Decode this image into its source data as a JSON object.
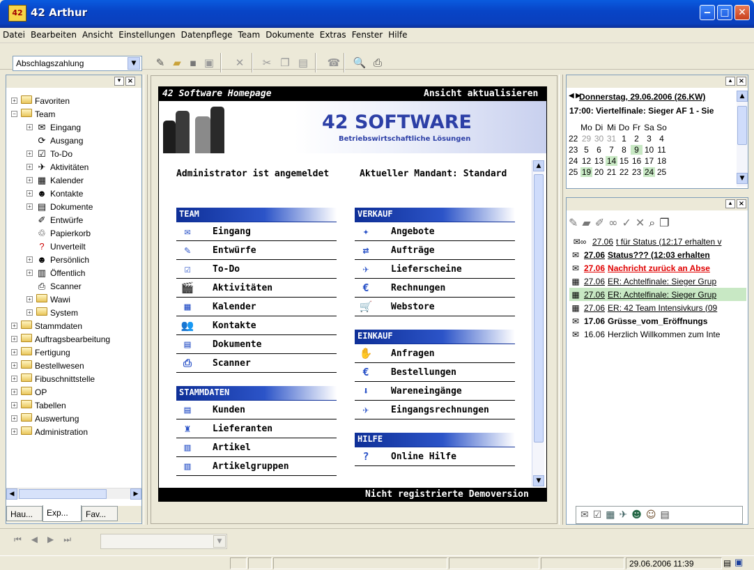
{
  "window": {
    "title": "42 Arthur",
    "icon": "42"
  },
  "menu": [
    "Datei",
    "Bearbeiten",
    "Ansicht",
    "Einstellungen",
    "Datenpflege",
    "Team",
    "Dokumente",
    "Extras",
    "Fenster",
    "Hilfe"
  ],
  "toolbar": {
    "combo_value": "Abschlagszahlung"
  },
  "tree": [
    {
      "label": "Favoriten",
      "level": 0,
      "toggle": "+",
      "icon": "favorites-folder-icon"
    },
    {
      "label": "Team",
      "level": 0,
      "toggle": "−",
      "icon": "folder-icon"
    },
    {
      "label": "Eingang",
      "level": 1,
      "toggle": "+",
      "icon": "envelope-icon"
    },
    {
      "label": "Ausgang",
      "level": 1,
      "toggle": "",
      "icon": "outbox-icon"
    },
    {
      "label": "To-Do",
      "level": 1,
      "toggle": "+",
      "icon": "todo-icon"
    },
    {
      "label": "Aktivitäten",
      "level": 1,
      "toggle": "+",
      "icon": "activities-icon"
    },
    {
      "label": "Kalender",
      "level": 1,
      "toggle": "+",
      "icon": "calendar-icon"
    },
    {
      "label": "Kontakte",
      "level": 1,
      "toggle": "+",
      "icon": "contacts-icon"
    },
    {
      "label": "Dokumente",
      "level": 1,
      "toggle": "+",
      "icon": "documents-icon"
    },
    {
      "label": "Entwürfe",
      "level": 1,
      "toggle": "",
      "icon": "drafts-icon"
    },
    {
      "label": "Papierkorb",
      "level": 1,
      "toggle": "",
      "icon": "trash-icon"
    },
    {
      "label": "Unverteilt",
      "level": 1,
      "toggle": "",
      "icon": "question-icon"
    },
    {
      "label": "Persönlich",
      "level": 1,
      "toggle": "+",
      "icon": "personal-icon"
    },
    {
      "label": "Öffentlich",
      "level": 1,
      "toggle": "+",
      "icon": "public-icon"
    },
    {
      "label": "Scanner",
      "level": 1,
      "toggle": "",
      "icon": "scanner-icon"
    },
    {
      "label": "Wawi",
      "level": 1,
      "toggle": "+",
      "icon": "folder-icon"
    },
    {
      "label": "System",
      "level": 1,
      "toggle": "+",
      "icon": "folder-icon"
    },
    {
      "label": "Stammdaten",
      "level": 0,
      "toggle": "+",
      "icon": "folder-icon"
    },
    {
      "label": "Auftragsbearbeitung",
      "level": 0,
      "toggle": "+",
      "icon": "folder-icon"
    },
    {
      "label": "Fertigung",
      "level": 0,
      "toggle": "+",
      "icon": "folder-icon"
    },
    {
      "label": "Bestellwesen",
      "level": 0,
      "toggle": "+",
      "icon": "folder-icon"
    },
    {
      "label": "Fibuschnittstelle",
      "level": 0,
      "toggle": "+",
      "icon": "folder-icon"
    },
    {
      "label": "OP",
      "level": 0,
      "toggle": "+",
      "icon": "folder-icon"
    },
    {
      "label": "Tabellen",
      "level": 0,
      "toggle": "+",
      "icon": "folder-icon"
    },
    {
      "label": "Auswertung",
      "level": 0,
      "toggle": "+",
      "icon": "folder-icon"
    },
    {
      "label": "Administration",
      "level": 0,
      "toggle": "+",
      "icon": "folder-icon"
    }
  ],
  "left_tabs": [
    "Hau...",
    "Exp...",
    "Fav..."
  ],
  "homepage": {
    "title": "42 Software Homepage",
    "refresh": "Ansicht aktualisieren",
    "brand": "42 SOFTWARE",
    "tagline": "Betriebswirtschaftliche Lösungen",
    "admin": "Administrator ist angemeldet",
    "mandant": "Aktueller Mandant: Standard",
    "footer": "Nicht registrierte Demoversion",
    "left_sections": [
      {
        "title": "TEAM",
        "items": [
          {
            "label": "Eingang",
            "icon": "envelope-icon",
            "glyph": "✉"
          },
          {
            "label": "Entwürfe",
            "icon": "drafts-icon",
            "glyph": "✎"
          },
          {
            "label": "To-Do",
            "icon": "todo-icon",
            "glyph": "☑"
          },
          {
            "label": "Aktivitäten",
            "icon": "activities-icon",
            "glyph": "🎬"
          },
          {
            "label": "Kalender",
            "icon": "calendar-icon",
            "glyph": "▦"
          },
          {
            "label": "Kontakte",
            "icon": "contacts-icon",
            "glyph": "👥"
          },
          {
            "label": "Dokumente",
            "icon": "documents-icon",
            "glyph": "▤"
          },
          {
            "label": "Scanner",
            "icon": "scanner-icon",
            "glyph": "⎙"
          }
        ]
      },
      {
        "title": "STAMMDATEN",
        "items": [
          {
            "label": "Kunden",
            "icon": "customers-icon",
            "glyph": "▤"
          },
          {
            "label": "Lieferanten",
            "icon": "suppliers-icon",
            "glyph": "♜"
          },
          {
            "label": "Artikel",
            "icon": "barcode-icon",
            "glyph": "▥"
          },
          {
            "label": "Artikelgruppen",
            "icon": "barcode-group-icon",
            "glyph": "▥"
          }
        ]
      }
    ],
    "right_sections": [
      {
        "title": "VERKAUF",
        "items": [
          {
            "label": "Angebote",
            "icon": "offers-icon",
            "glyph": "✦"
          },
          {
            "label": "Aufträge",
            "icon": "orders-icon",
            "glyph": "⇄"
          },
          {
            "label": "Lieferscheine",
            "icon": "delivery-icon",
            "glyph": "✈"
          },
          {
            "label": "Rechnungen",
            "icon": "invoice-icon",
            "glyph": "€"
          },
          {
            "label": "Webstore",
            "icon": "cart-icon",
            "glyph": "🛒"
          }
        ]
      },
      {
        "title": "EINKAUF",
        "items": [
          {
            "label": "Anfragen",
            "icon": "requests-icon",
            "glyph": "✋"
          },
          {
            "label": "Bestellungen",
            "icon": "order-euro-icon",
            "glyph": "€"
          },
          {
            "label": "Wareneingänge",
            "icon": "goods-receipt-icon",
            "glyph": "⬇"
          },
          {
            "label": "Eingangsrechnungen",
            "icon": "incoming-invoice-icon",
            "glyph": "✈"
          }
        ]
      },
      {
        "title": "HILFE",
        "items": [
          {
            "label": "Online Hilfe",
            "icon": "help-icon",
            "glyph": "?"
          }
        ]
      }
    ]
  },
  "calendar": {
    "date_title": "Donnerstag, 29.06.2006 (26.KW)",
    "event": "17:00: Viertelfinale: Sieger AF 1 - Sie",
    "weekdays": [
      "Mo",
      "Di",
      "Mi",
      "Do",
      "Fr",
      "Sa",
      "So"
    ],
    "weeks": [
      {
        "kw": "22",
        "days": [
          {
            "d": "29",
            "dim": true
          },
          {
            "d": "30",
            "dim": true
          },
          {
            "d": "31",
            "dim": true
          },
          {
            "d": "1"
          },
          {
            "d": "2"
          },
          {
            "d": "3"
          },
          {
            "d": "4"
          }
        ]
      },
      {
        "kw": "23",
        "days": [
          {
            "d": "5"
          },
          {
            "d": "6"
          },
          {
            "d": "7"
          },
          {
            "d": "8"
          },
          {
            "d": "9",
            "hl": true
          },
          {
            "d": "10"
          },
          {
            "d": "11"
          }
        ]
      },
      {
        "kw": "24",
        "days": [
          {
            "d": "12"
          },
          {
            "d": "13"
          },
          {
            "d": "14",
            "hl": true
          },
          {
            "d": "15"
          },
          {
            "d": "16"
          },
          {
            "d": "17"
          },
          {
            "d": "18"
          }
        ]
      },
      {
        "kw": "25",
        "days": [
          {
            "d": "19",
            "hl": true
          },
          {
            "d": "20"
          },
          {
            "d": "21"
          },
          {
            "d": "22"
          },
          {
            "d": "23"
          },
          {
            "d": "24",
            "hl": true
          },
          {
            "d": "25"
          }
        ]
      }
    ]
  },
  "messages": [
    {
      "icon": "mail-glasses-icon",
      "date": "27.06",
      "text": "t für Status (12:17 erhalten v",
      "style": "underline"
    },
    {
      "icon": "mail-icon",
      "date": "27.06",
      "text": "Status??? (12:03 erhalten",
      "style": "bold-underline"
    },
    {
      "icon": "mail-icon",
      "date": "27.06",
      "text": "Nachricht zurück an Abse",
      "style": "red-bold"
    },
    {
      "icon": "calendar-msg-icon",
      "date": "27.06",
      "text": "ER: Achtelfinale: Sieger Grup",
      "style": "underline"
    },
    {
      "icon": "calendar-msg-icon",
      "date": "27.06",
      "text": "ER: Achtelfinale: Sieger Grup",
      "style": "selected"
    },
    {
      "icon": "calendar-msg-icon",
      "date": "27.06",
      "text": "ER: 42 Team Intensivkurs (09",
      "style": "underline"
    },
    {
      "icon": "mail-icon",
      "date": "17.06",
      "text": "Grüsse_vom_Eröffnungs",
      "style": "bold"
    },
    {
      "icon": "mail-icon",
      "date": "16.06",
      "text": "Herzlich Willkommen zum Inte",
      "style": "normal"
    }
  ],
  "status": {
    "datetime": "29.06.2006 11:39"
  },
  "colors": {
    "title_blue": "#0a4fd8",
    "section_blue": "#0e2f97",
    "highlight_green": "#c8e8c4",
    "alert_red": "#e00000"
  }
}
